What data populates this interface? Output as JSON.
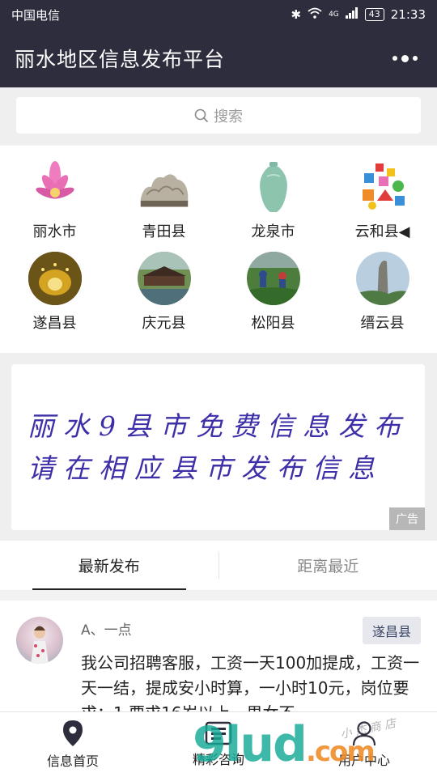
{
  "status_bar": {
    "carrier": "中国电信",
    "network": "4G",
    "battery": "43",
    "time": "21:33"
  },
  "header": {
    "title": "丽水地区信息发布平台"
  },
  "search": {
    "placeholder": "搜索"
  },
  "regions": [
    {
      "label": "丽水市",
      "icon": "lotus-icon"
    },
    {
      "label": "青田县",
      "icon": "stone-carving-icon"
    },
    {
      "label": "龙泉市",
      "icon": "celadon-vase-icon"
    },
    {
      "label": "云和县◀",
      "icon": "wooden-toys-icon"
    },
    {
      "label": "遂昌县",
      "icon": "tunnel-photo"
    },
    {
      "label": "庆元县",
      "icon": "covered-bridge-photo"
    },
    {
      "label": "松阳县",
      "icon": "tea-pickers-photo"
    },
    {
      "label": "缙云县",
      "icon": "rock-peak-photo"
    }
  ],
  "ad": {
    "line1": "丽水9县市免费信息发布",
    "line2": "请在相应县市发布信息",
    "tag": "广告"
  },
  "tabs": [
    {
      "label": "最新发布",
      "active": true
    },
    {
      "label": "距离最近",
      "active": false
    }
  ],
  "post": {
    "author": "A、一点",
    "region": "遂昌县",
    "text": "我公司招聘客服，工资一天100加提成，工资一天一结，提成安小时算，一小时10元，岗位要求：1.要求16岁以上，男女不"
  },
  "bottom_nav": [
    {
      "label": "信息首页",
      "icon": "location-pin-icon"
    },
    {
      "label": "精彩咨询",
      "icon": "newspaper-icon"
    },
    {
      "label": "用户中心",
      "icon": "user-icon"
    }
  ],
  "watermark": {
    "main": "9lud",
    "suffix": ".com",
    "small": "小 杰 商 店"
  },
  "colors": {
    "header_bg": "#2e2d3d",
    "ad_text": "#3d2fa8",
    "badge_bg": "#e6e8ee"
  }
}
